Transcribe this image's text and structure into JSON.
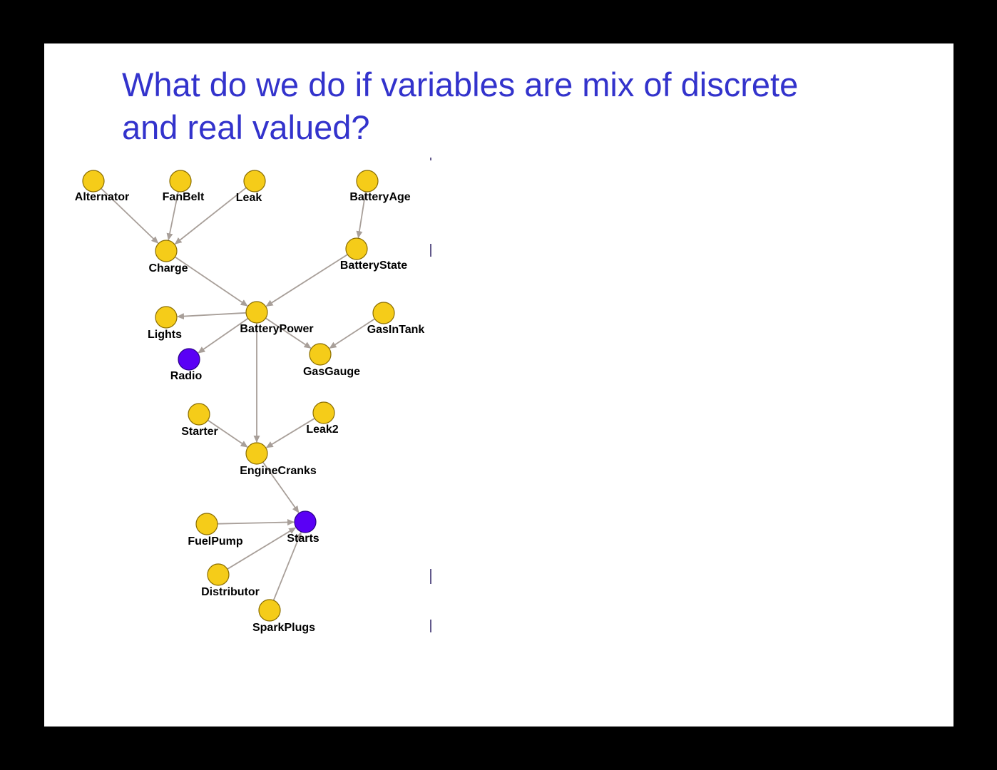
{
  "slide": {
    "title_line1": "What do we do if variables are mix of discrete",
    "title_line2": "and real valued?"
  },
  "colors": {
    "title": "#3333cc",
    "node_default": "#f5cc19",
    "node_highlight": "#5a00f5",
    "edge": "#a89f99",
    "background": "#ffffff",
    "frame": "#000000"
  },
  "diagram": {
    "nodes": [
      {
        "id": "Alternator",
        "label": "Alternator",
        "highlight": false
      },
      {
        "id": "FanBelt",
        "label": "FanBelt",
        "highlight": false
      },
      {
        "id": "Leak",
        "label": "Leak",
        "highlight": false
      },
      {
        "id": "BatteryAge",
        "label": "BatteryAge",
        "highlight": false
      },
      {
        "id": "Charge",
        "label": "Charge",
        "highlight": false
      },
      {
        "id": "BatteryState",
        "label": "BatteryState",
        "highlight": false
      },
      {
        "id": "BatteryPower",
        "label": "BatteryPower",
        "highlight": false
      },
      {
        "id": "Lights",
        "label": "Lights",
        "highlight": false
      },
      {
        "id": "GasInTank",
        "label": "GasInTank",
        "highlight": false
      },
      {
        "id": "Radio",
        "label": "Radio",
        "highlight": true
      },
      {
        "id": "GasGauge",
        "label": "GasGauge",
        "highlight": false
      },
      {
        "id": "Starter",
        "label": "Starter",
        "highlight": false
      },
      {
        "id": "Leak2",
        "label": "Leak2",
        "highlight": false
      },
      {
        "id": "EngineCranks",
        "label": "EngineCranks",
        "highlight": false
      },
      {
        "id": "FuelPump",
        "label": "FuelPump",
        "highlight": false
      },
      {
        "id": "Starts",
        "label": "Starts",
        "highlight": true
      },
      {
        "id": "Distributor",
        "label": "Distributor",
        "highlight": false
      },
      {
        "id": "SparkPlugs",
        "label": "SparkPlugs",
        "highlight": false
      }
    ],
    "edges": [
      {
        "from": "Alternator",
        "to": "Charge"
      },
      {
        "from": "FanBelt",
        "to": "Charge"
      },
      {
        "from": "Leak",
        "to": "Charge"
      },
      {
        "from": "BatteryAge",
        "to": "BatteryState"
      },
      {
        "from": "Charge",
        "to": "BatteryPower"
      },
      {
        "from": "BatteryState",
        "to": "BatteryPower"
      },
      {
        "from": "BatteryPower",
        "to": "Lights"
      },
      {
        "from": "BatteryPower",
        "to": "Radio"
      },
      {
        "from": "BatteryPower",
        "to": "GasGauge"
      },
      {
        "from": "GasInTank",
        "to": "GasGauge"
      },
      {
        "from": "BatteryPower",
        "to": "EngineCranks"
      },
      {
        "from": "Starter",
        "to": "EngineCranks"
      },
      {
        "from": "Leak2",
        "to": "EngineCranks"
      },
      {
        "from": "EngineCranks",
        "to": "Starts"
      },
      {
        "from": "FuelPump",
        "to": "Starts"
      },
      {
        "from": "Distributor",
        "to": "Starts"
      },
      {
        "from": "SparkPlugs",
        "to": "Starts"
      }
    ]
  }
}
